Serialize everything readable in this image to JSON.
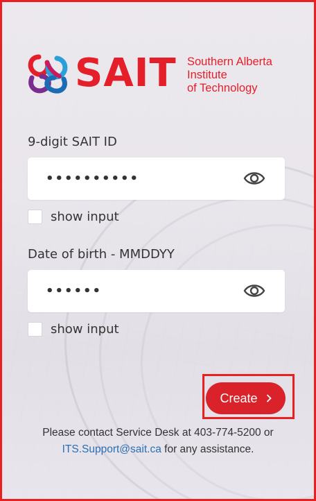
{
  "brand": {
    "name": "SAIT",
    "subtitle": [
      "Southern Alberta",
      "Institute",
      "of Technology"
    ],
    "color": "#e41f2a"
  },
  "form": {
    "id_field": {
      "label": "9-digit SAIT ID",
      "masked_value": "••••••••••",
      "show_input_label": "show input",
      "show_input_checked": false,
      "toggle_icon": "eye-icon"
    },
    "dob_field": {
      "label": "Date of birth - MMDDYY",
      "masked_value": "••••••",
      "show_input_label": "show input",
      "show_input_checked": false,
      "toggle_icon": "eye-icon"
    },
    "submit": {
      "label": "Create",
      "icon": "chevron-right-icon",
      "color": "#d9222a"
    }
  },
  "help": {
    "text_before": "Please contact Service Desk at 403-774-5200 or",
    "email": "ITS.Support@sait.ca",
    "text_after": " for any assistance."
  },
  "colors": {
    "highlight_border": "#e8201f",
    "link": "#2a6fb5"
  }
}
